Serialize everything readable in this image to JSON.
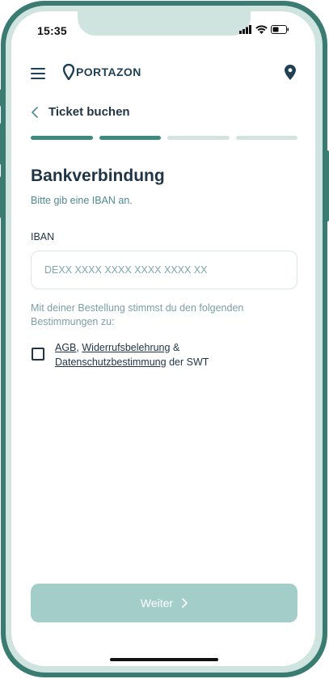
{
  "status_bar": {
    "time": "15:35"
  },
  "app": {
    "brand": "PORTAZON",
    "icons": {
      "menu": "hamburger-menu-icon",
      "logo": "map-pin-icon",
      "location": "map-pin-icon",
      "back": "chevron-left-icon",
      "forward": "chevron-right-icon"
    },
    "colors": {
      "primary": "#1f4055",
      "accent": "#3f8a7e",
      "progress_inactive": "#d5e3e0",
      "button_disabled": "#a3cdc9",
      "frame": "#3b7c72"
    }
  },
  "nav": {
    "back_title": "Ticket buchen"
  },
  "progress": {
    "total_steps": 4,
    "completed_steps": 2
  },
  "form": {
    "title": "Bankverbindung",
    "subtitle": "Bitte gib eine IBAN an.",
    "iban_label": "IBAN",
    "iban_placeholder": "DEXX XXXX XXXX XXXX XXXX XX",
    "iban_value": ""
  },
  "terms": {
    "intro": "Mit deiner Bestellung stimmst du den folgenden Bestimmungen zu:",
    "checked": false,
    "link_agb": "AGB",
    "separator_comma": ",",
    "link_widerruf": "Widerrufsbelehrung",
    "separator_amp": "&",
    "link_datenschutz": "Datenschutzbestimmung",
    "suffix": "der SWT"
  },
  "footer": {
    "button_label": "Weiter",
    "button_enabled": false
  }
}
